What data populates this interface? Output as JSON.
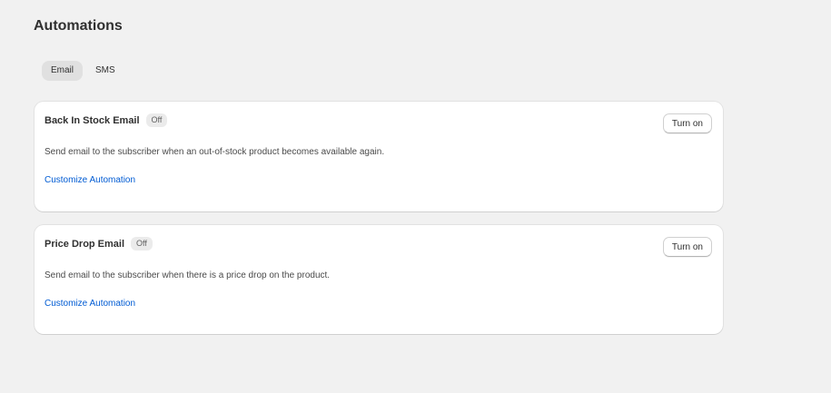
{
  "page": {
    "title": "Automations"
  },
  "tabs": [
    {
      "label": "Email",
      "active": true
    },
    {
      "label": "SMS",
      "active": false
    }
  ],
  "automations": [
    {
      "title": "Back In Stock Email",
      "status": "Off",
      "action_label": "Turn on",
      "description": "Send email to the subscriber when an out-of-stock product becomes available again.",
      "link_label": "Customize Automation"
    },
    {
      "title": "Price Drop Email",
      "status": "Off",
      "action_label": "Turn on",
      "description": "Send email to the subscriber when there is a price drop on the product.",
      "link_label": "Customize Automation"
    }
  ],
  "colors": {
    "background": "#f1f1f1",
    "card": "#ffffff",
    "link": "#005bd3",
    "active_tab": "#e0e0e0",
    "badge": "#ebebeb"
  }
}
